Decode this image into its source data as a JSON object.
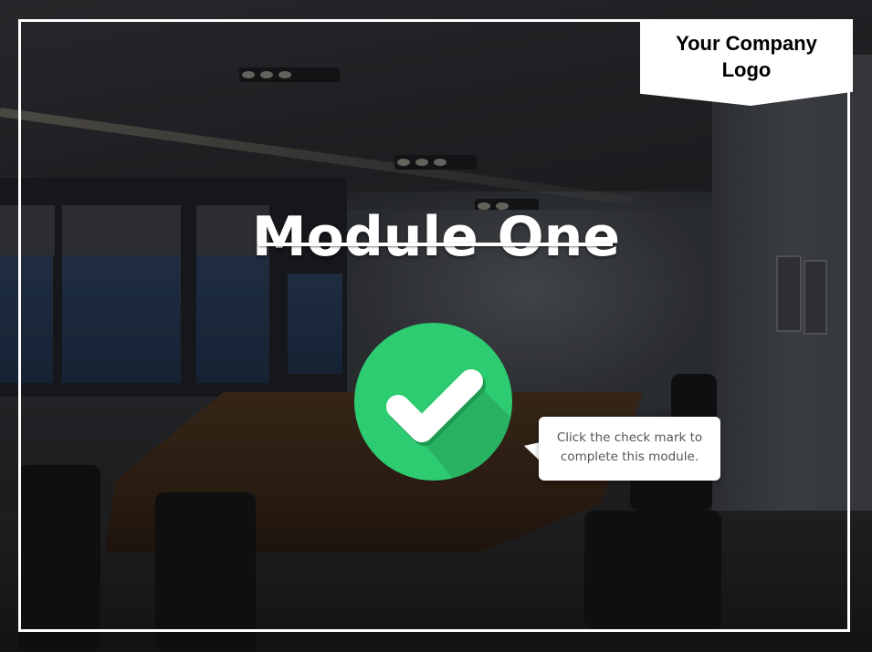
{
  "logo": {
    "text": "Your Company Logo"
  },
  "module": {
    "title": "Module One"
  },
  "complete_button": {
    "icon": "check-mark-icon",
    "color": "#2ecc71"
  },
  "callout": {
    "text": "Click the check mark to complete this module."
  }
}
